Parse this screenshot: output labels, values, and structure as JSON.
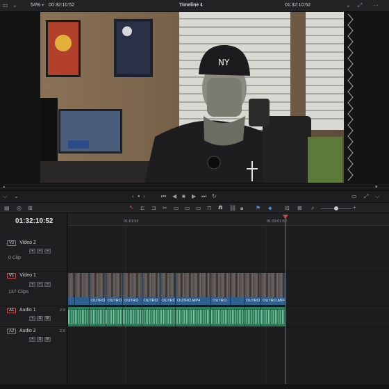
{
  "topbar": {
    "zoom": "54%",
    "source_timecode": "00:32:10:52",
    "timeline_name": "Timeline 1",
    "record_timecode": "01:32:10:52"
  },
  "timeline": {
    "current_timecode": "01:32:10:52",
    "ruler_marks": [
      "01:01:52",
      "01:32:01:52"
    ]
  },
  "tracks": {
    "v2": {
      "id": "V2",
      "name": "Video 2",
      "clips": "0 Clip"
    },
    "v1": {
      "id": "V1",
      "name": "Video 1",
      "clips": "137 Clips"
    },
    "a1": {
      "id": "A1",
      "name": "Audio 1",
      "channels": "2.0"
    },
    "a2": {
      "id": "A2",
      "name": "Audio 2",
      "channels": "2.0"
    }
  },
  "clip_label": "OUTRO.MP4",
  "clip_labels_short": [
    "OUTRO",
    "OUTRO",
    "OUTRO",
    "OUTRO",
    "OUTRO",
    "OUTRO.MP4",
    "OUTRO",
    "OUTRO",
    "OUTRO",
    "OUTRO.MP4"
  ],
  "colors": {
    "accent_red": "#e0404a",
    "video_clip": "#2f5f8f",
    "audio_clip": "#2e7a5a"
  }
}
